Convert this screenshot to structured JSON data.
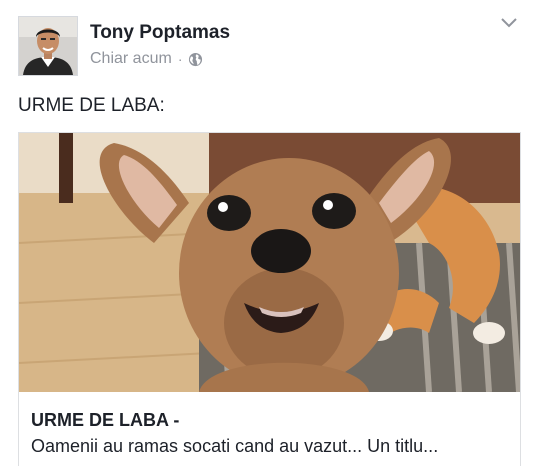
{
  "post": {
    "author": "Tony Poptamas",
    "timestamp": "Chiar acum",
    "separator": "·",
    "privacy_icon": "globe-icon",
    "menu_icon": "chevron-down-icon",
    "text": "URME DE LABA:"
  },
  "link_card": {
    "title": "URME DE LABA -",
    "description": "Oamenii au ramas socati cand au vazut... Un titlu..."
  },
  "colors": {
    "meta_text": "#90949c",
    "body_text": "#1d2129",
    "card_border": "#dddfe2"
  }
}
